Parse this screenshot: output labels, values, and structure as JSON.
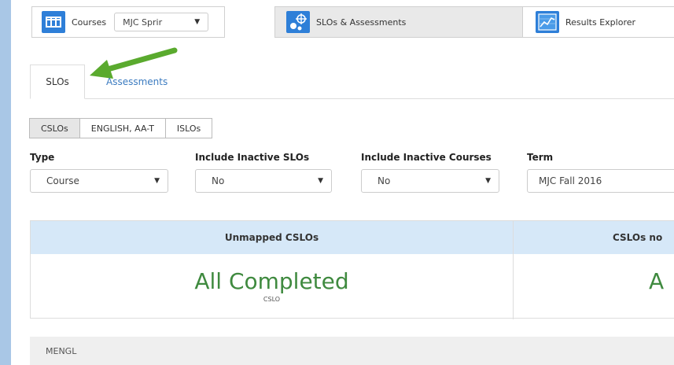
{
  "topnav": {
    "courses_label": "Courses",
    "term_select_value": "MJC Sprir",
    "slos_label": "SLOs & Assessments",
    "results_label": "Results Explorer"
  },
  "subtabs": [
    {
      "label": "SLOs",
      "active": true
    },
    {
      "label": "Assessments",
      "active": false
    }
  ],
  "toggles": [
    {
      "label": "CSLOs",
      "active": true
    },
    {
      "label": "ENGLISH, AA-T",
      "active": false
    },
    {
      "label": "ISLOs",
      "active": false
    }
  ],
  "filters": [
    {
      "label": "Type",
      "value": "Course"
    },
    {
      "label": "Include Inactive SLOs",
      "value": "No"
    },
    {
      "label": "Include Inactive Courses",
      "value": "No"
    },
    {
      "label": "Term",
      "value": "MJC Fall 2016"
    }
  ],
  "summary": {
    "left_header": "Unmapped CSLOs",
    "left_value": "All Completed",
    "left_sub": "CSLO",
    "right_header": "CSLOs no",
    "right_value": "A"
  },
  "bottom_row": "MENGL",
  "colors": {
    "accent": "#2e7fd8",
    "header_blue": "#d6e8f8",
    "completed_green": "#3f8a3f",
    "arrow_green": "#5aaa2e"
  }
}
